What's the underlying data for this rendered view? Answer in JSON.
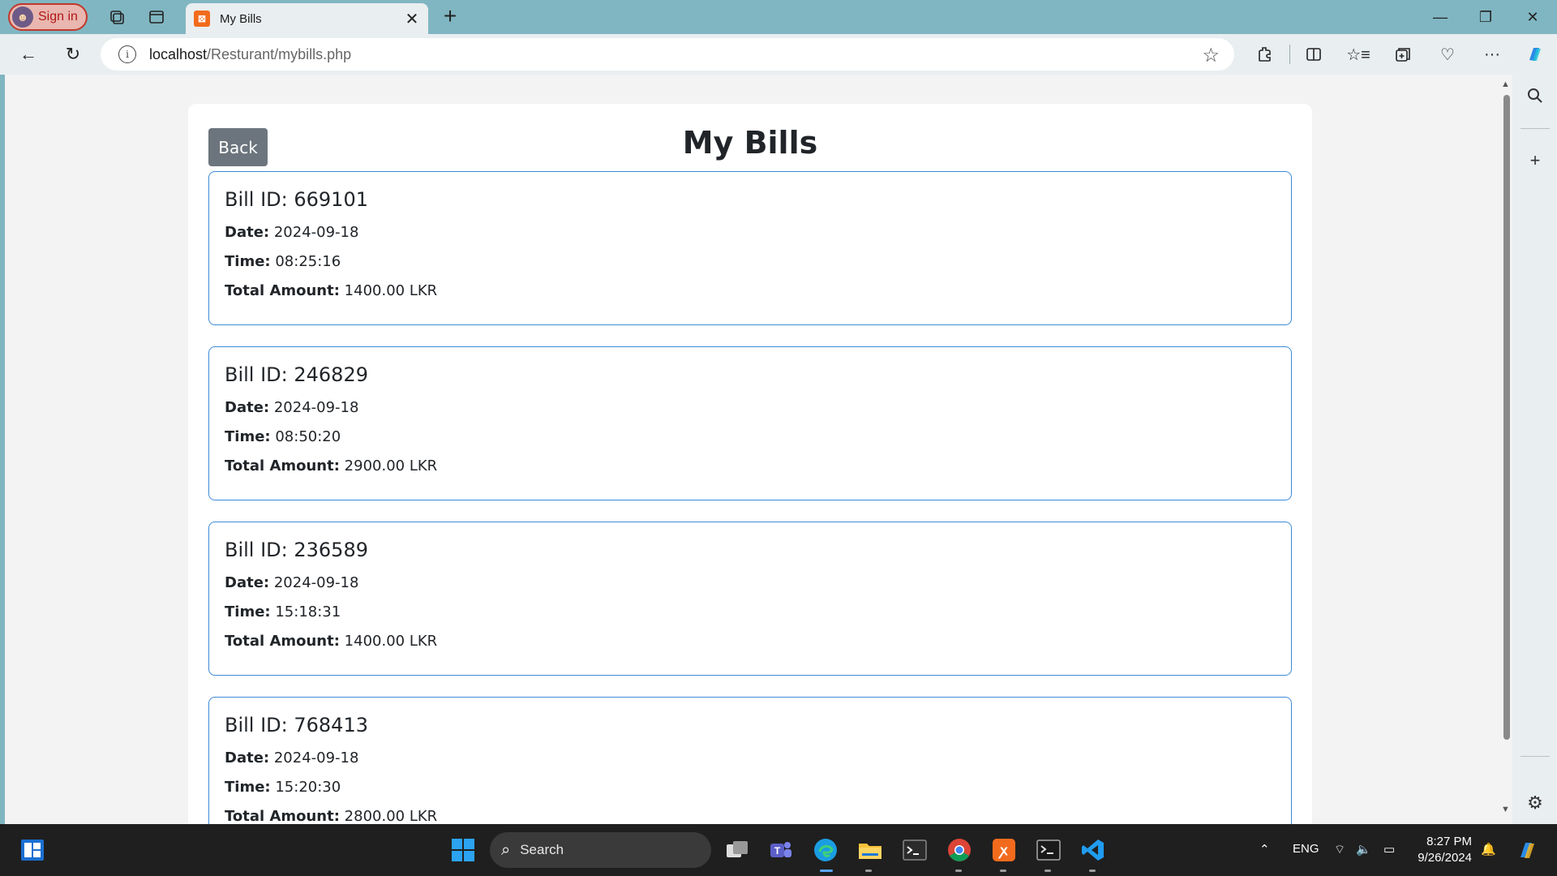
{
  "browser": {
    "profile_label": "Sign in",
    "tab_title": "My Bills",
    "url_host": "localhost",
    "url_path": "/Resturant/mybills.php"
  },
  "page": {
    "title": "My Bills",
    "back_label": "Back",
    "labels": {
      "date": "Date:",
      "time": "Time:",
      "total": "Total Amount:"
    },
    "bills": [
      {
        "heading": "Bill ID: 669101",
        "date": "2024-09-18",
        "time": "08:25:16",
        "total": "1400.00 LKR"
      },
      {
        "heading": "Bill ID: 246829",
        "date": "2024-09-18",
        "time": "08:50:20",
        "total": "2900.00 LKR"
      },
      {
        "heading": "Bill ID: 236589",
        "date": "2024-09-18",
        "time": "15:18:31",
        "total": "1400.00 LKR"
      },
      {
        "heading": "Bill ID: 768413",
        "date": "2024-09-18",
        "time": "15:20:30",
        "total": "2800.00 LKR"
      }
    ]
  },
  "taskbar": {
    "search_label": "Search",
    "language": "ENG",
    "time": "8:27 PM",
    "date": "9/26/2024"
  },
  "colors": {
    "titlebar": "#80b6c2",
    "card_border": "#3d8bd9",
    "back_button": "#6c757d",
    "profile_border": "#c0392b"
  },
  "icons": [
    "windows-start-icon",
    "search-icon",
    "edge-icon",
    "chrome-icon",
    "xampp-icon",
    "vscode-icon",
    "terminal-icon",
    "file-explorer-icon",
    "teams-icon",
    "task-view-icon"
  ]
}
